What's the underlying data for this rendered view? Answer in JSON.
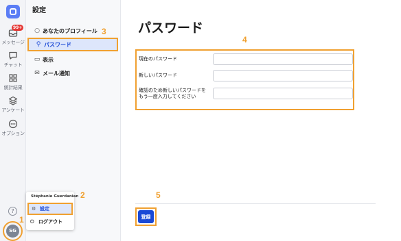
{
  "rail": {
    "badge": "99+",
    "items": [
      {
        "label": "メッセージ",
        "icon": "inbox-icon"
      },
      {
        "label": "チャット",
        "icon": "chat-icon"
      },
      {
        "label": "統計結果",
        "icon": "grid-icon"
      },
      {
        "label": "アンケート",
        "icon": "layers-icon"
      },
      {
        "label": "オプション",
        "icon": "more-icon"
      }
    ],
    "help": "?",
    "avatar": "SG"
  },
  "nav": {
    "title": "設定",
    "items": [
      {
        "label": "あなたのプロフィール",
        "icon": "user-icon"
      },
      {
        "label": "パスワード",
        "icon": "key-icon"
      },
      {
        "label": "表示",
        "icon": "monitor-icon"
      },
      {
        "label": "メール通知",
        "icon": "mail-icon"
      }
    ]
  },
  "user_menu": {
    "name": "Stéphanie Guerdanian",
    "settings": "設定",
    "logout": "ログアウト"
  },
  "main": {
    "title": "パスワード",
    "fields": [
      {
        "label": "現在のパスワード",
        "value": ""
      },
      {
        "label": "新しいパスワード",
        "value": ""
      },
      {
        "label": "確認のため新しいパスワードをもう一度入力してください",
        "value": ""
      }
    ],
    "save": "登録"
  },
  "annotations": [
    "1",
    "2",
    "3",
    "4",
    "5"
  ],
  "colors": {
    "accent": "#1a49d6",
    "highlight": "#f0a030"
  }
}
